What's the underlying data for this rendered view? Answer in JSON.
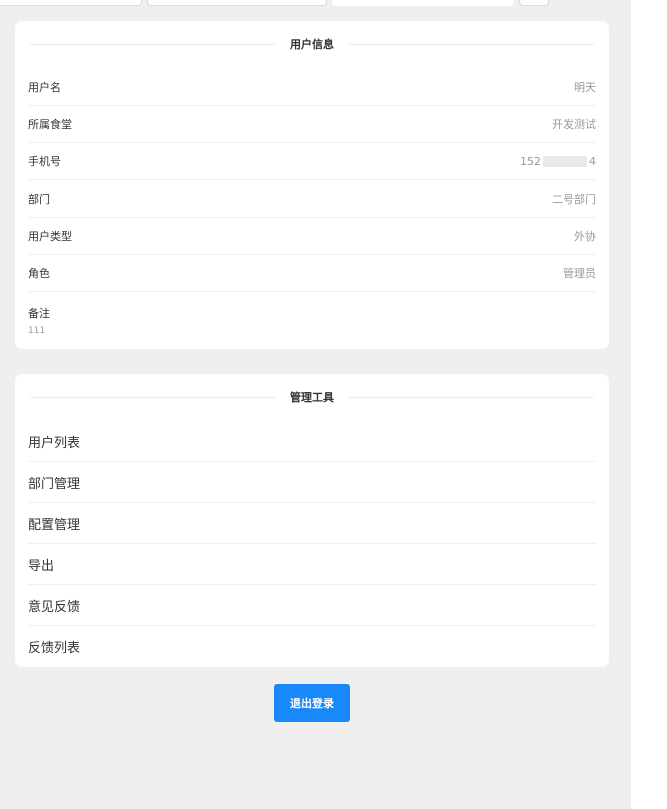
{
  "user_info": {
    "title": "用户信息",
    "rows": [
      {
        "label": "用户名",
        "value": "明天"
      },
      {
        "label": "所属食堂",
        "value": "开发测试"
      },
      {
        "label": "手机号",
        "value_prefix": "152",
        "value_suffix": "4"
      },
      {
        "label": "部门",
        "value": "二号部门"
      },
      {
        "label": "用户类型",
        "value": "外协"
      },
      {
        "label": "角色",
        "value": "管理员"
      }
    ],
    "remark_label": "备注",
    "remark_value": "111"
  },
  "tools": {
    "title": "管理工具",
    "items": [
      "用户列表",
      "部门管理",
      "配置管理",
      "导出",
      "意见反馈",
      "反馈列表"
    ]
  },
  "logout_label": "退出登录",
  "colors": {
    "primary": "#1989fa",
    "background": "#efefef"
  }
}
